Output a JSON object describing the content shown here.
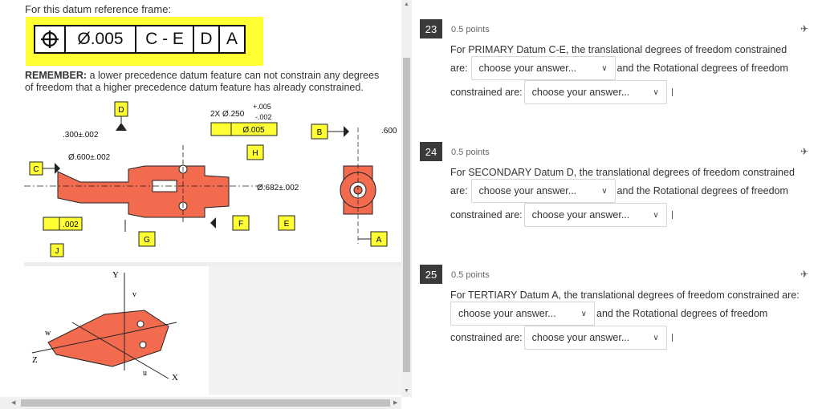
{
  "left": {
    "intro": "For this datum reference frame:",
    "fcf": {
      "symbol": "⌖",
      "tolerance": "Ø.005",
      "primary": "C - E",
      "secondary": "D",
      "tertiary": "A"
    },
    "remember_bold": "REMEMBER:",
    "remember_text": " a lower precedence datum feature can not constrain any degrees of freedom that a higher precedence datum feature has already constrained.",
    "drawing": {
      "labels": {
        "d": "D",
        "c": "C",
        "b": "B",
        "h": "H",
        "f": "F",
        "e": "E",
        "a": "A",
        "g": "G",
        "j": "J",
        "dim300": ".300±.002",
        "dim600": "Ø.600±.002",
        "dim682": "Ø.682±.002",
        "dim600b": ".600",
        "hole_pre": "2X Ø.250",
        "hole_plus": "+.005",
        "hole_minus": "-.002",
        "pos_tol": "Ø.005",
        "flat": ".002"
      }
    },
    "dof": {
      "y": "Y",
      "v": "v",
      "w": "w",
      "z": "Z",
      "u": "u",
      "x": "X"
    },
    "colors": {
      "part": "#f26b4f",
      "datum_box": "#ffff33"
    }
  },
  "questions": [
    {
      "number": "23",
      "points": "0.5 points",
      "text": "For PRIMARY Datum C-E, the translational degrees of freedom constrained",
      "prefix": "are:",
      "select1": "choose your answer...",
      "mid": "and the Rotational degrees of freedom",
      "prefix2": "constrained are:",
      "select2": "choose your answer..."
    },
    {
      "number": "24",
      "points": "0.5 points",
      "text": "For SECONDARY Datum D, the translational degrees of freedom constrained",
      "prefix": "are:",
      "select1": "choose your answer...",
      "mid": "and the Rotational degrees of freedom",
      "prefix2": "constrained are:",
      "select2": "choose your answer..."
    },
    {
      "number": "25",
      "points": "0.5 points",
      "text": "For TERTIARY Datum A, the translational degrees of freedom constrained are:",
      "prefix": "",
      "select1": "choose your answer...",
      "mid": "and the Rotational degrees of freedom",
      "prefix2": "constrained are:",
      "select2": "choose your answer..."
    }
  ]
}
